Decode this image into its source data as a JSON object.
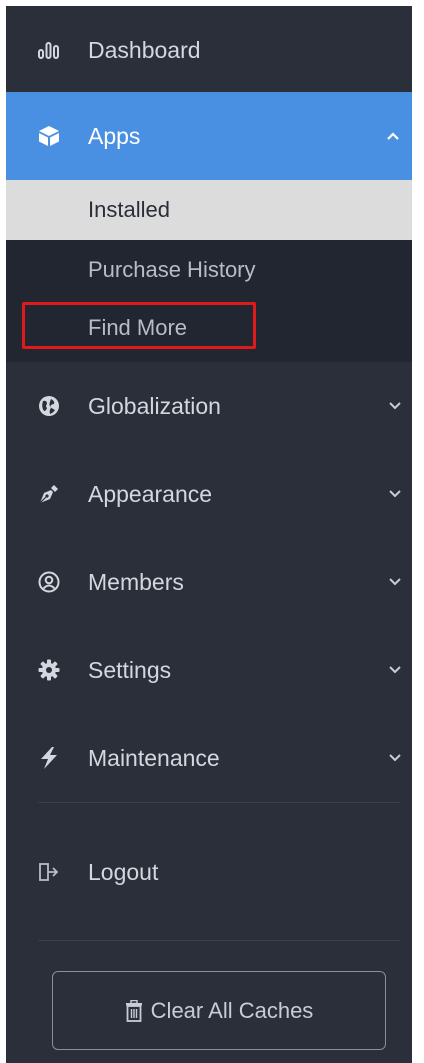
{
  "sidebar": {
    "dashboard": {
      "label": "Dashboard",
      "icon": "bar-chart-icon"
    },
    "apps": {
      "label": "Apps",
      "icon": "cube-icon",
      "expanded": true,
      "children": [
        {
          "label": "Installed"
        },
        {
          "label": "Purchase History"
        },
        {
          "label": "Find More"
        }
      ]
    },
    "globalization": {
      "label": "Globalization",
      "icon": "globe-icon"
    },
    "appearance": {
      "label": "Appearance",
      "icon": "pen-nib-icon"
    },
    "members": {
      "label": "Members",
      "icon": "user-circle-icon"
    },
    "settings": {
      "label": "Settings",
      "icon": "gear-icon"
    },
    "maintenance": {
      "label": "Maintenance",
      "icon": "bolt-icon"
    },
    "logout": {
      "label": "Logout",
      "icon": "sign-out-icon"
    },
    "clear_caches": {
      "label": "Clear All Caches",
      "icon": "trash-icon"
    }
  },
  "colors": {
    "sidebar_bg": "#2b2f3a",
    "submenu_bg": "#222630",
    "active_bg": "#4a90e2",
    "selected_sub_bg": "#dcdcdc",
    "highlight_border": "#e01a1a"
  }
}
